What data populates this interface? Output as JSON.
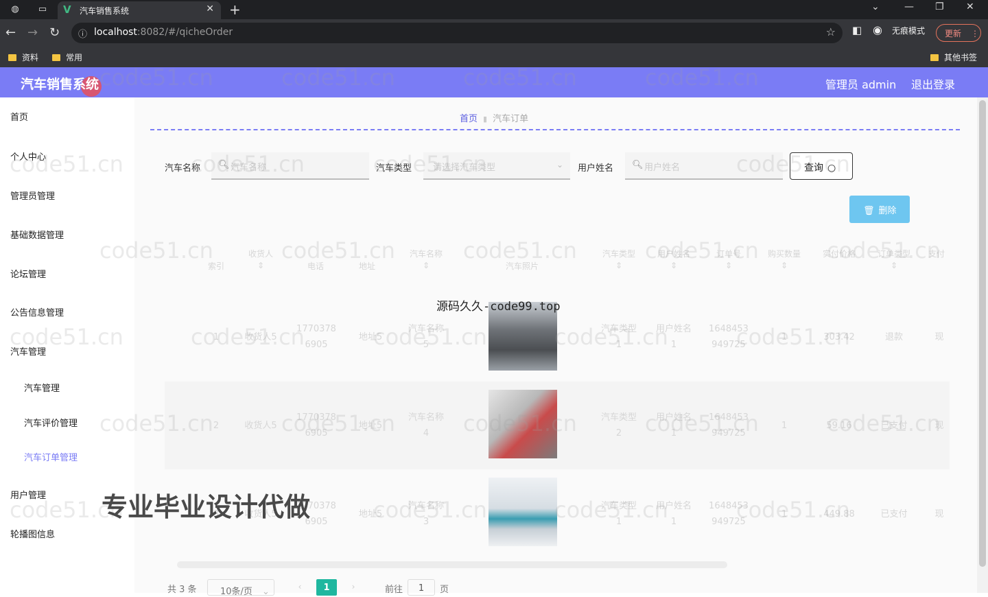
{
  "browser": {
    "tab_title": "汽车销售系统",
    "url_host": "localhost",
    "url_path": ":8082/#/qicheOrder",
    "incognito_label": "无痕模式",
    "update_label": "更新",
    "bookmarks": [
      "资料",
      "常用"
    ],
    "other_bookmarks": "其他书签"
  },
  "header": {
    "brand": "汽车销售系统",
    "user_label": "管理员 admin",
    "logout_label": "退出登录"
  },
  "sidebar": {
    "items": [
      {
        "label": "首页"
      },
      {
        "label": "个人中心"
      },
      {
        "label": "管理员管理"
      },
      {
        "label": "基础数据管理"
      },
      {
        "label": "论坛管理"
      },
      {
        "label": "公告信息管理"
      },
      {
        "label": "汽车管理"
      }
    ],
    "sub_items": [
      {
        "label": "汽车管理"
      },
      {
        "label": "汽车评价管理"
      },
      {
        "label": "汽车订单管理"
      }
    ],
    "items2": [
      {
        "label": "用户管理"
      },
      {
        "label": "轮播图信息"
      }
    ]
  },
  "breadcrumb": {
    "home": "首页",
    "current": "汽车订单"
  },
  "search": {
    "car_name_label": "汽车名称",
    "car_name_placeholder": "汽车名称",
    "car_type_label": "汽车类型",
    "car_type_placeholder": "请选择汽车类型",
    "user_name_label": "用户姓名",
    "user_name_placeholder": "用户姓名",
    "query_label": "查询"
  },
  "actions": {
    "delete_label": "删除"
  },
  "table": {
    "headers": [
      {
        "l1": "",
        "l2": "索引"
      },
      {
        "l1": "收货人",
        "l2": ""
      },
      {
        "l1": "",
        "l2": "电话"
      },
      {
        "l1": "",
        "l2": "地址"
      },
      {
        "l1": "汽车名称",
        "l2": ""
      },
      {
        "l1": "",
        "l2": "汽车照片"
      },
      {
        "l1": "汽车类型",
        "l2": ""
      },
      {
        "l1": "用户姓名",
        "l2": ""
      },
      {
        "l1": "订单号",
        "l2": ""
      },
      {
        "l1": "购买数量",
        "l2": ""
      },
      {
        "l1": "实付价格",
        "l2": ""
      },
      {
        "l1": "订单类型",
        "l2": ""
      },
      {
        "l1": "支付",
        "l2": ""
      }
    ],
    "rows": [
      {
        "index": "1",
        "receiver": "收货人5",
        "phone1": "1770378",
        "phone2": "6905",
        "address": "地址5",
        "car1": "汽车名称",
        "car2": "5",
        "type1": "汽车类型",
        "type2": "1",
        "user1": "用户姓名",
        "user2": "1",
        "order1": "1648453",
        "order2": "949725",
        "qty": "1",
        "price": "303.42",
        "status": "退款",
        "pay": "现"
      },
      {
        "index": "2",
        "receiver": "收货人5",
        "phone1": "1770378",
        "phone2": "6905",
        "address": "地址5",
        "car1": "汽车名称",
        "car2": "4",
        "type1": "汽车类型",
        "type2": "2",
        "user1": "用户姓名",
        "user2": "1",
        "order1": "1648453",
        "order2": "949725",
        "qty": "1",
        "price": "59.16",
        "status": "已支付",
        "pay": "现"
      },
      {
        "index": "3",
        "receiver": "收货人5",
        "phone1": "1770378",
        "phone2": "6905",
        "address": "地址5",
        "car1": "汽车名称",
        "car2": "3",
        "type1": "汽车类型",
        "type2": "1",
        "user1": "用户姓名",
        "user2": "1",
        "order1": "1648453",
        "order2": "949725",
        "qty": "1",
        "price": "449.88",
        "status": "已支付",
        "pay": "现"
      }
    ]
  },
  "pagination": {
    "total": "共 3 条",
    "page_size": "10条/页",
    "current": "1",
    "goto_prefix": "前往",
    "goto_value": "1",
    "goto_suffix": "页"
  },
  "overlays": {
    "watermark": "code51.cn",
    "center_text": "源码久久-code99.top",
    "banner_text": "专业毕业设计代做"
  }
}
